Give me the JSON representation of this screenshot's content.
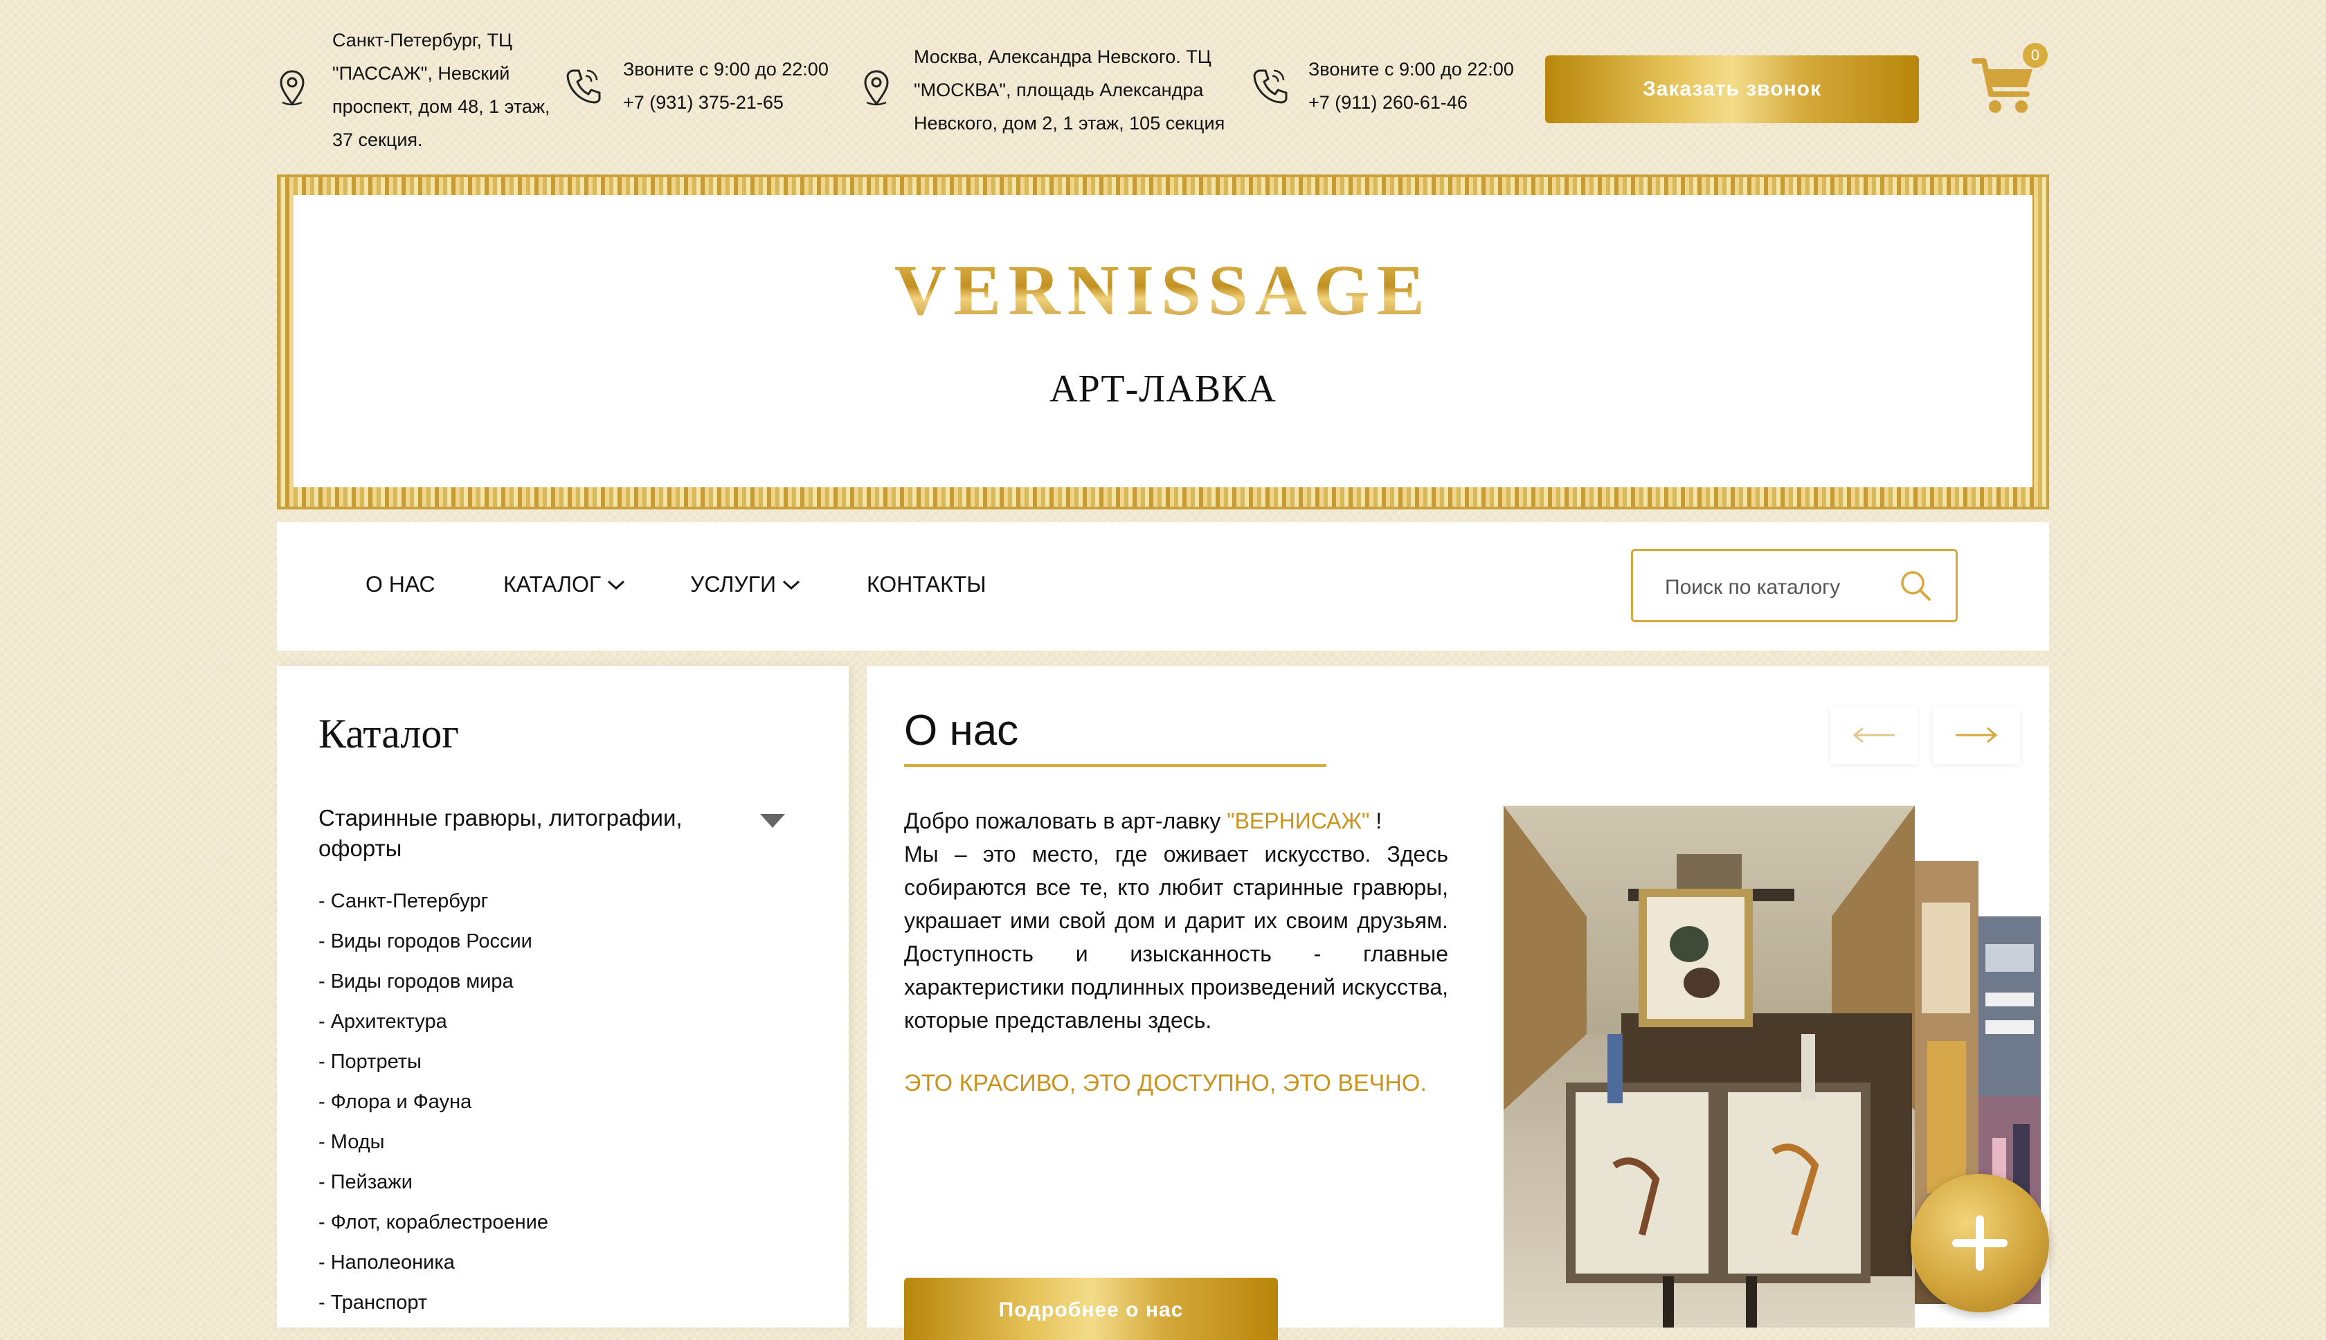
{
  "header": {
    "address_spb": {
      "lines": [
        "Санкт-Петербург, ТЦ",
        "\"ПАССАЖ\", Невский",
        "проспект, дом 48, 1 этаж,",
        "37 секция."
      ]
    },
    "phone_spb": {
      "hours": "Звоните с 9:00 до 22:00",
      "number": "+7 (931) 375-21-65"
    },
    "address_msk": {
      "lines": [
        "Москва, Александра Невского. ТЦ",
        "\"МОСКВА\", площадь Александра",
        "Невского, дом 2, 1 этаж, 105 секция"
      ]
    },
    "phone_msk": {
      "hours": "Звоните с 9:00 до 22:00",
      "number": "+7 (911) 260-61-46"
    },
    "callback_label": "Заказать звонок",
    "cart_count": "0"
  },
  "banner": {
    "brand": "VERNISSAGE",
    "subtitle": "АРТ-ЛАВКА"
  },
  "nav": {
    "items": [
      {
        "label": "О НАС",
        "has_dropdown": false
      },
      {
        "label": "КАТАЛОГ",
        "has_dropdown": true
      },
      {
        "label": "УСЛУГИ",
        "has_dropdown": true
      },
      {
        "label": "КОНТАКТЫ",
        "has_dropdown": false
      }
    ],
    "search_placeholder": "Поиск по каталогу"
  },
  "sidebar": {
    "title": "Каталог",
    "category": "Старинные гравюры, литографии, офорты",
    "subcategories": [
      "- Санкт-Петербург",
      "- Виды городов России",
      "- Виды городов мира",
      "- Архитектура",
      "- Портреты",
      "- Флора и Фауна",
      "- Моды",
      "- Пейзажи",
      "- Флот, кораблестроение",
      "- Наполеоника",
      "- Транспорт"
    ]
  },
  "main": {
    "title": "О нас",
    "welcome_prefix": "Добро пожаловать в арт-лавку",
    "welcome_brand": "\"ВЕРНИСАЖ\"",
    "welcome_suffix": "!",
    "body": "Мы – это место, где оживает искусство. Здесь собираются все те, кто любит старинные гравюры, украшает ими свой дом и дарит их своим друзьям. Доступность и изысканность - главные характеристики подлинных произведений искусства, которые представлены здесь.",
    "slogan": "ЭТО КРАСИВО, ЭТО ДОСТУПНО, ЭТО ВЕЧНО.",
    "more_button": "Подробнее о нас"
  },
  "colors": {
    "gold": "#d6a93a",
    "accent_text": "#c9941e",
    "page_bg": "#f1e9d2"
  },
  "icons": [
    "location-pin-icon",
    "phone-icon",
    "cart-icon",
    "search-icon",
    "chevron-down-icon",
    "arrow-left-icon",
    "arrow-right-icon",
    "plus-icon"
  ]
}
